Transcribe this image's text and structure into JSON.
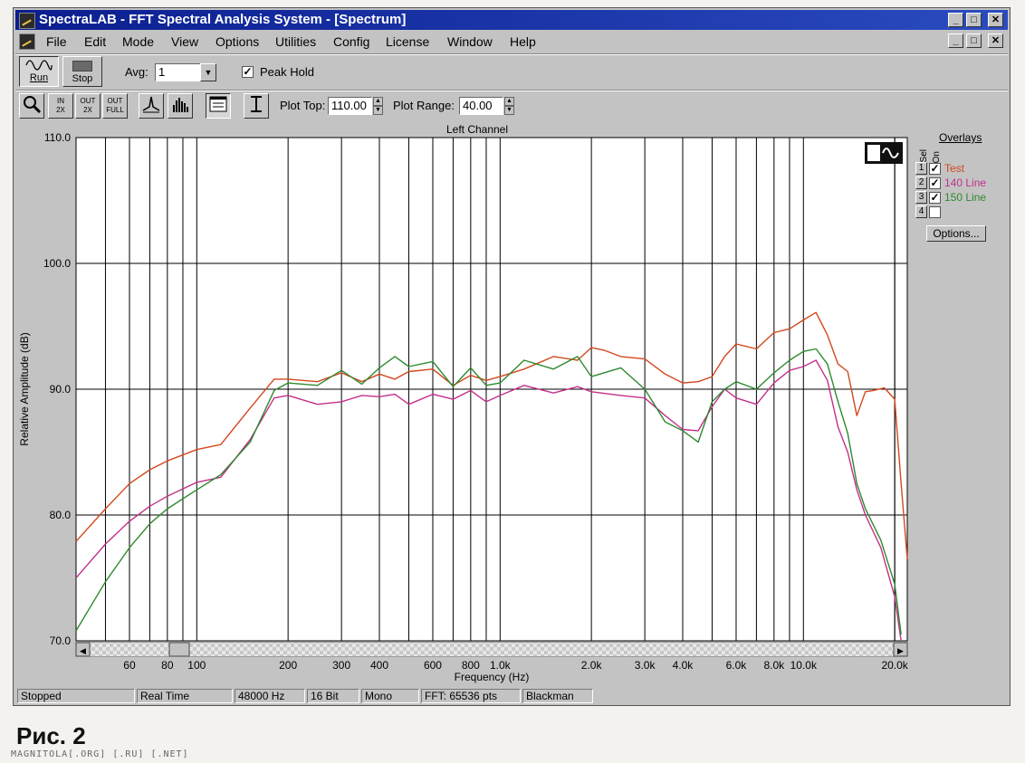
{
  "window": {
    "title": "SpectraLAB - FFT Spectral Analysis System - [Spectrum]",
    "min": "_",
    "max": "□",
    "close": "✕"
  },
  "menu": [
    "File",
    "Edit",
    "Mode",
    "View",
    "Options",
    "Utilities",
    "Config",
    "License",
    "Window",
    "Help"
  ],
  "toolbar": {
    "run_label": "Run",
    "stop_label": "Stop",
    "avg_label": "Avg:",
    "avg_value": "1",
    "peak_hold_label": "Peak Hold",
    "peak_hold_checked": true,
    "plot_top_label": "Plot Top:",
    "plot_top_value": "110.00",
    "plot_range_label": "Plot Range:",
    "plot_range_value": "40.00",
    "zoom_in_label": "IN\n2X",
    "zoom_out_label": "OUT\n2X",
    "zoom_full_label": "OUT\nFULL"
  },
  "overlays": {
    "title": "Overlays",
    "sel_label": "Sel",
    "on_label": "On",
    "items": [
      {
        "num": "1",
        "checked": true,
        "name": "Test",
        "color": "#d2481e"
      },
      {
        "num": "2",
        "checked": true,
        "name": "140 Line",
        "color": "#c2308a"
      },
      {
        "num": "3",
        "checked": true,
        "name": "150 Line",
        "color": "#2e8a2e"
      },
      {
        "num": "4",
        "checked": false,
        "name": "",
        "color": "#000000"
      }
    ],
    "options_label": "Options..."
  },
  "status": [
    "Stopped",
    "Real Time",
    "48000 Hz",
    "16 Bit",
    "Mono",
    "FFT: 65536 pts",
    "Blackman"
  ],
  "caption": "Рис. 2",
  "footer": "MAGNITOLA[.ORG] [.RU] [.NET]",
  "chart_data": {
    "type": "line",
    "title": "Left Channel",
    "xlabel": "Frequency (Hz)",
    "ylabel": "Relative Amplitude (dB)",
    "x_scale": "log",
    "xlim": [
      40,
      22000
    ],
    "ylim": [
      70,
      110
    ],
    "y_ticks": [
      "110.0",
      "100.0",
      "90.0",
      "80.0",
      "70.0"
    ],
    "x_ticks": [
      {
        "v": 60,
        "t": "60"
      },
      {
        "v": 80,
        "t": "80"
      },
      {
        "v": 100,
        "t": "100"
      },
      {
        "v": 200,
        "t": "200"
      },
      {
        "v": 300,
        "t": "300"
      },
      {
        "v": 400,
        "t": "400"
      },
      {
        "v": 600,
        "t": "600"
      },
      {
        "v": 800,
        "t": "800"
      },
      {
        "v": 1000,
        "t": "1.0k"
      },
      {
        "v": 2000,
        "t": "2.0k"
      },
      {
        "v": 3000,
        "t": "3.0k"
      },
      {
        "v": 4000,
        "t": "4.0k"
      },
      {
        "v": 6000,
        "t": "6.0k"
      },
      {
        "v": 8000,
        "t": "8.0k"
      },
      {
        "v": 10000,
        "t": "10.0k"
      },
      {
        "v": 20000,
        "t": "20.0k"
      }
    ],
    "grid": true,
    "series": [
      {
        "name": "Test",
        "color": "#d2481e",
        "points": [
          [
            40,
            77.9
          ],
          [
            50,
            80.5
          ],
          [
            60,
            82.5
          ],
          [
            70,
            83.6
          ],
          [
            80,
            84.3
          ],
          [
            100,
            85.2
          ],
          [
            120,
            85.6
          ],
          [
            150,
            88.5
          ],
          [
            180,
            90.8
          ],
          [
            200,
            90.8
          ],
          [
            250,
            90.6
          ],
          [
            300,
            91.3
          ],
          [
            350,
            90.6
          ],
          [
            400,
            91.2
          ],
          [
            450,
            90.8
          ],
          [
            500,
            91.4
          ],
          [
            600,
            91.6
          ],
          [
            700,
            90.3
          ],
          [
            800,
            91.1
          ],
          [
            900,
            90.7
          ],
          [
            1000,
            91.0
          ],
          [
            1200,
            91.6
          ],
          [
            1500,
            92.6
          ],
          [
            1800,
            92.3
          ],
          [
            2000,
            93.3
          ],
          [
            2200,
            93.1
          ],
          [
            2500,
            92.6
          ],
          [
            3000,
            92.4
          ],
          [
            3500,
            91.2
          ],
          [
            4000,
            90.5
          ],
          [
            4500,
            90.6
          ],
          [
            5000,
            91.0
          ],
          [
            5500,
            92.6
          ],
          [
            6000,
            93.6
          ],
          [
            7000,
            93.2
          ],
          [
            8000,
            94.5
          ],
          [
            9000,
            94.8
          ],
          [
            10000,
            95.5
          ],
          [
            11000,
            96.1
          ],
          [
            12000,
            94.3
          ],
          [
            13000,
            92.0
          ],
          [
            14000,
            91.4
          ],
          [
            15000,
            87.9
          ],
          [
            16000,
            89.8
          ],
          [
            17000,
            89.9
          ],
          [
            18500,
            90.1
          ],
          [
            20000,
            89.2
          ],
          [
            21000,
            82.5
          ],
          [
            22000,
            76.5
          ]
        ]
      },
      {
        "name": "140 Line",
        "color": "#c2308a",
        "points": [
          [
            40,
            75.0
          ],
          [
            50,
            77.7
          ],
          [
            60,
            79.5
          ],
          [
            70,
            80.7
          ],
          [
            80,
            81.5
          ],
          [
            100,
            82.6
          ],
          [
            120,
            83.0
          ],
          [
            150,
            86.0
          ],
          [
            180,
            89.3
          ],
          [
            200,
            89.5
          ],
          [
            250,
            88.8
          ],
          [
            300,
            89.0
          ],
          [
            350,
            89.5
          ],
          [
            400,
            89.4
          ],
          [
            450,
            89.6
          ],
          [
            500,
            88.8
          ],
          [
            600,
            89.6
          ],
          [
            700,
            89.2
          ],
          [
            800,
            89.9
          ],
          [
            900,
            89.0
          ],
          [
            1000,
            89.5
          ],
          [
            1200,
            90.3
          ],
          [
            1500,
            89.7
          ],
          [
            1800,
            90.2
          ],
          [
            2000,
            89.8
          ],
          [
            2500,
            89.5
          ],
          [
            3000,
            89.3
          ],
          [
            3500,
            87.9
          ],
          [
            4000,
            86.8
          ],
          [
            4500,
            86.7
          ],
          [
            5000,
            88.6
          ],
          [
            5500,
            90.0
          ],
          [
            6000,
            89.3
          ],
          [
            7000,
            88.8
          ],
          [
            8000,
            90.5
          ],
          [
            9000,
            91.5
          ],
          [
            10000,
            91.8
          ],
          [
            11000,
            92.3
          ],
          [
            12000,
            90.7
          ],
          [
            13000,
            87.0
          ],
          [
            14000,
            85.0
          ],
          [
            15000,
            82.0
          ],
          [
            16000,
            80.0
          ],
          [
            18000,
            77.4
          ],
          [
            20000,
            73.5
          ],
          [
            21000,
            70.0
          ]
        ]
      },
      {
        "name": "150 Line",
        "color": "#2e8a2e",
        "points": [
          [
            40,
            70.8
          ],
          [
            50,
            74.7
          ],
          [
            60,
            77.4
          ],
          [
            70,
            79.3
          ],
          [
            80,
            80.5
          ],
          [
            100,
            82.0
          ],
          [
            120,
            83.2
          ],
          [
            150,
            85.8
          ],
          [
            180,
            89.9
          ],
          [
            200,
            90.5
          ],
          [
            250,
            90.3
          ],
          [
            300,
            91.5
          ],
          [
            350,
            90.4
          ],
          [
            400,
            91.7
          ],
          [
            450,
            92.6
          ],
          [
            500,
            91.8
          ],
          [
            600,
            92.2
          ],
          [
            700,
            90.2
          ],
          [
            800,
            91.7
          ],
          [
            900,
            90.3
          ],
          [
            1000,
            90.5
          ],
          [
            1200,
            92.3
          ],
          [
            1500,
            91.6
          ],
          [
            1800,
            92.6
          ],
          [
            2000,
            91.0
          ],
          [
            2500,
            91.7
          ],
          [
            3000,
            90.0
          ],
          [
            3500,
            87.4
          ],
          [
            4000,
            86.7
          ],
          [
            4500,
            85.8
          ],
          [
            5000,
            89.0
          ],
          [
            5500,
            90.0
          ],
          [
            6000,
            90.6
          ],
          [
            7000,
            90.0
          ],
          [
            8000,
            91.3
          ],
          [
            9000,
            92.3
          ],
          [
            10000,
            93.0
          ],
          [
            11000,
            93.2
          ],
          [
            12000,
            92.0
          ],
          [
            13000,
            89.0
          ],
          [
            14000,
            86.5
          ],
          [
            15000,
            82.5
          ],
          [
            16000,
            80.5
          ],
          [
            18000,
            78.0
          ],
          [
            20000,
            74.5
          ],
          [
            21000,
            70.5
          ]
        ]
      }
    ]
  }
}
